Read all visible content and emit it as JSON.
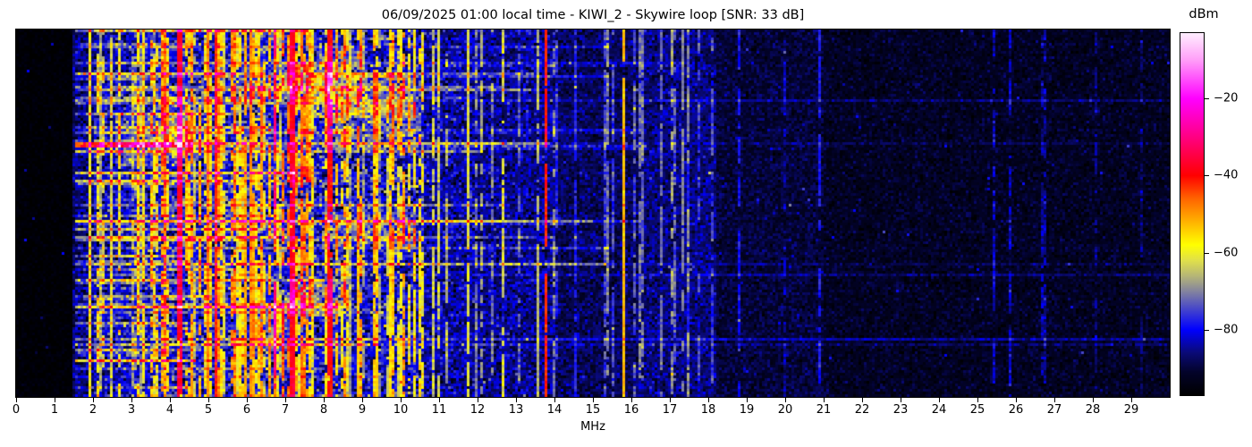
{
  "title": "06/09/2025 01:00 local time - KIWI_2 - Skywire loop [SNR: 33 dB]",
  "xaxis": {
    "label": "MHz",
    "min": 0,
    "max": 30,
    "ticks": [
      0,
      1,
      2,
      3,
      4,
      5,
      6,
      7,
      8,
      9,
      10,
      11,
      12,
      13,
      14,
      15,
      16,
      17,
      18,
      19,
      20,
      21,
      22,
      23,
      24,
      25,
      26,
      27,
      28,
      29
    ]
  },
  "colorbar": {
    "label": "dBm",
    "vmin": -97,
    "vmax": -3,
    "ticks": [
      -20,
      -40,
      -60,
      -80
    ]
  },
  "chart_data": {
    "type": "heatmap",
    "subtype": "hf-spectrogram-waterfall",
    "title": "06/09/2025 01:00 local time - KIWI_2 - Skywire loop [SNR: 33 dB]",
    "xlabel": "MHz",
    "value_unit": "dBm",
    "x_range_mhz": [
      0,
      30
    ],
    "value_range_dbm": [
      -97,
      -3
    ],
    "snr_db": 33,
    "summary": "Night-time HF waterfall: black (no signal) below 1.5 MHz; dense broadcast/utility activity 1.5-10.5 MHz with strong red carriers near 4.25, 5.2, 6.7, 7.2, 8.15 and 13.8 MHz; steady yellow carrier at 15.77 MHz; bands fade to quiet dark noise floor above 18 MHz; many horizontal static-crash streaks below 10 MHz and a faint persistent horizontal line near 84% height on the upper bands.",
    "colormap_stops": [
      {
        "v": -97,
        "rgb": [
          0,
          0,
          0
        ]
      },
      {
        "v": -91,
        "rgb": [
          3,
          3,
          42
        ]
      },
      {
        "v": -86,
        "rgb": [
          10,
          10,
          118
        ]
      },
      {
        "v": -80,
        "rgb": [
          0,
          0,
          255
        ]
      },
      {
        "v": -74,
        "rgb": [
          78,
          78,
          196
        ]
      },
      {
        "v": -70,
        "rgb": [
          132,
          132,
          158
        ]
      },
      {
        "v": -66,
        "rgb": [
          182,
          182,
          118
        ]
      },
      {
        "v": -62,
        "rgb": [
          224,
          224,
          74
        ]
      },
      {
        "v": -58,
        "rgb": [
          255,
          255,
          0
        ]
      },
      {
        "v": -52,
        "rgb": [
          255,
          178,
          0
        ]
      },
      {
        "v": -46,
        "rgb": [
          255,
          100,
          0
        ]
      },
      {
        "v": -40,
        "rgb": [
          255,
          0,
          0
        ]
      },
      {
        "v": -30,
        "rgb": [
          255,
          0,
          130
        ]
      },
      {
        "v": -20,
        "rgb": [
          255,
          0,
          255
        ]
      },
      {
        "v": -10,
        "rgb": [
          255,
          158,
          248
        ]
      },
      {
        "v": -3,
        "rgb": [
          255,
          238,
          255
        ]
      }
    ],
    "synthesis": {
      "seed": 1337,
      "rows": 137,
      "cols": 430,
      "regions": [
        {
          "f0": 0.0,
          "f1": 1.5,
          "floor": -96,
          "sd": 1.0,
          "density": 0.0,
          "s0": -90,
          "s1": -88
        },
        {
          "f0": 1.5,
          "f1": 2.0,
          "floor": -87,
          "sd": 3.5,
          "density": 0.12,
          "s0": -76,
          "s1": -62
        },
        {
          "f0": 2.0,
          "f1": 2.6,
          "floor": -83,
          "sd": 4.5,
          "density": 0.25,
          "s0": -74,
          "s1": -56
        },
        {
          "f0": 2.6,
          "f1": 3.5,
          "floor": -82,
          "sd": 5.0,
          "density": 0.32,
          "s0": -72,
          "s1": -52
        },
        {
          "f0": 3.5,
          "f1": 5.6,
          "floor": -80,
          "sd": 6.0,
          "density": 0.6,
          "s0": -66,
          "s1": -47
        },
        {
          "f0": 5.6,
          "f1": 6.6,
          "floor": -79,
          "sd": 6.0,
          "density": 0.72,
          "s0": -62,
          "s1": -48
        },
        {
          "f0": 6.6,
          "f1": 8.6,
          "floor": -80,
          "sd": 6.0,
          "density": 0.55,
          "s0": -66,
          "s1": -46
        },
        {
          "f0": 8.6,
          "f1": 10.6,
          "floor": -81,
          "sd": 6.0,
          "density": 0.42,
          "s0": -70,
          "s1": -50
        },
        {
          "f0": 10.6,
          "f1": 12.0,
          "floor": -84,
          "sd": 4.5,
          "density": 0.22,
          "s0": -74,
          "s1": -58
        },
        {
          "f0": 12.0,
          "f1": 14.0,
          "floor": -85,
          "sd": 4.0,
          "density": 0.15,
          "s0": -76,
          "s1": -62
        },
        {
          "f0": 14.0,
          "f1": 16.2,
          "floor": -88,
          "sd": 3.0,
          "density": 0.1,
          "s0": -82,
          "s1": -70
        },
        {
          "f0": 16.2,
          "f1": 18.2,
          "floor": -86,
          "sd": 3.3,
          "density": 0.14,
          "s0": -78,
          "s1": -68
        },
        {
          "f0": 18.2,
          "f1": 21.0,
          "floor": -90,
          "sd": 2.5,
          "density": 0.06,
          "s0": -84,
          "s1": -78
        },
        {
          "f0": 21.0,
          "f1": 30.0,
          "floor": -92,
          "sd": 2.3,
          "density": 0.05,
          "s0": -88,
          "s1": -82
        }
      ],
      "carriers": [
        {
          "f": 1.93,
          "p": -60,
          "w": 1,
          "duty": 0.85
        },
        {
          "f": 2.18,
          "p": -68,
          "w": 1,
          "duty": 0.9
        },
        {
          "f": 2.46,
          "p": -63,
          "w": 1,
          "duty": 0.8
        },
        {
          "f": 3.2,
          "p": -58,
          "w": 1,
          "duty": 0.85
        },
        {
          "f": 3.33,
          "p": -60,
          "w": 1,
          "duty": 0.85
        },
        {
          "f": 3.9,
          "p": -55,
          "w": 1,
          "duty": 0.8
        },
        {
          "f": 4.24,
          "p": -38,
          "w": 2,
          "duty": 0.97
        },
        {
          "f": 4.6,
          "p": -52,
          "w": 1,
          "duty": 0.8
        },
        {
          "f": 5.0,
          "p": -50,
          "w": 1,
          "duty": 0.85
        },
        {
          "f": 5.2,
          "p": -42,
          "w": 1,
          "duty": 0.9
        },
        {
          "f": 5.95,
          "p": -52,
          "w": 1,
          "duty": 0.9
        },
        {
          "f": 6.07,
          "p": -50,
          "w": 1,
          "duty": 0.9
        },
        {
          "f": 6.18,
          "p": -53,
          "w": 1,
          "duty": 0.85
        },
        {
          "f": 6.7,
          "p": -32,
          "w": 1,
          "duty": 0.45
        },
        {
          "f": 7.21,
          "p": -38,
          "w": 2,
          "duty": 0.97
        },
        {
          "f": 7.45,
          "p": -48,
          "w": 1,
          "duty": 0.8
        },
        {
          "f": 8.15,
          "p": -40,
          "w": 2,
          "duty": 0.9
        },
        {
          "f": 8.9,
          "p": -54,
          "w": 1,
          "duty": 0.8
        },
        {
          "f": 9.4,
          "p": -55,
          "w": 1,
          "duty": 0.85
        },
        {
          "f": 9.7,
          "p": -56,
          "w": 1,
          "duty": 0.8
        },
        {
          "f": 10.0,
          "p": -60,
          "w": 1,
          "duty": 0.8
        },
        {
          "f": 11.0,
          "p": -63,
          "w": 1,
          "duty": 0.7
        },
        {
          "f": 11.76,
          "p": -62,
          "w": 1,
          "duty": 0.7
        },
        {
          "f": 12.1,
          "p": -68,
          "w": 1,
          "duty": 0.6
        },
        {
          "f": 13.57,
          "p": -66,
          "w": 1,
          "duty": 0.6
        },
        {
          "f": 13.8,
          "p": -42,
          "w": 1,
          "duty": 0.95
        },
        {
          "f": 14.55,
          "p": -78,
          "w": 1,
          "duty": 0.7
        },
        {
          "f": 15.77,
          "p": -53,
          "w": 1,
          "duty": 1.0
        },
        {
          "f": 16.8,
          "p": -72,
          "w": 1,
          "duty": 0.6
        },
        {
          "f": 17.35,
          "p": -70,
          "w": 1,
          "duty": 0.5
        },
        {
          "f": 17.5,
          "p": -78,
          "w": 1,
          "duty": 0.8
        },
        {
          "f": 20.9,
          "p": -78,
          "w": 1,
          "duty": 0.4
        }
      ],
      "streaks": {
        "count": 85,
        "f_min": 1.55,
        "full_width_count": 5,
        "blob_count": 12
      },
      "persistent_line": {
        "row_frac": 0.84,
        "f_start": 10.2,
        "boost": 8,
        "boost_low": 3
      }
    }
  }
}
